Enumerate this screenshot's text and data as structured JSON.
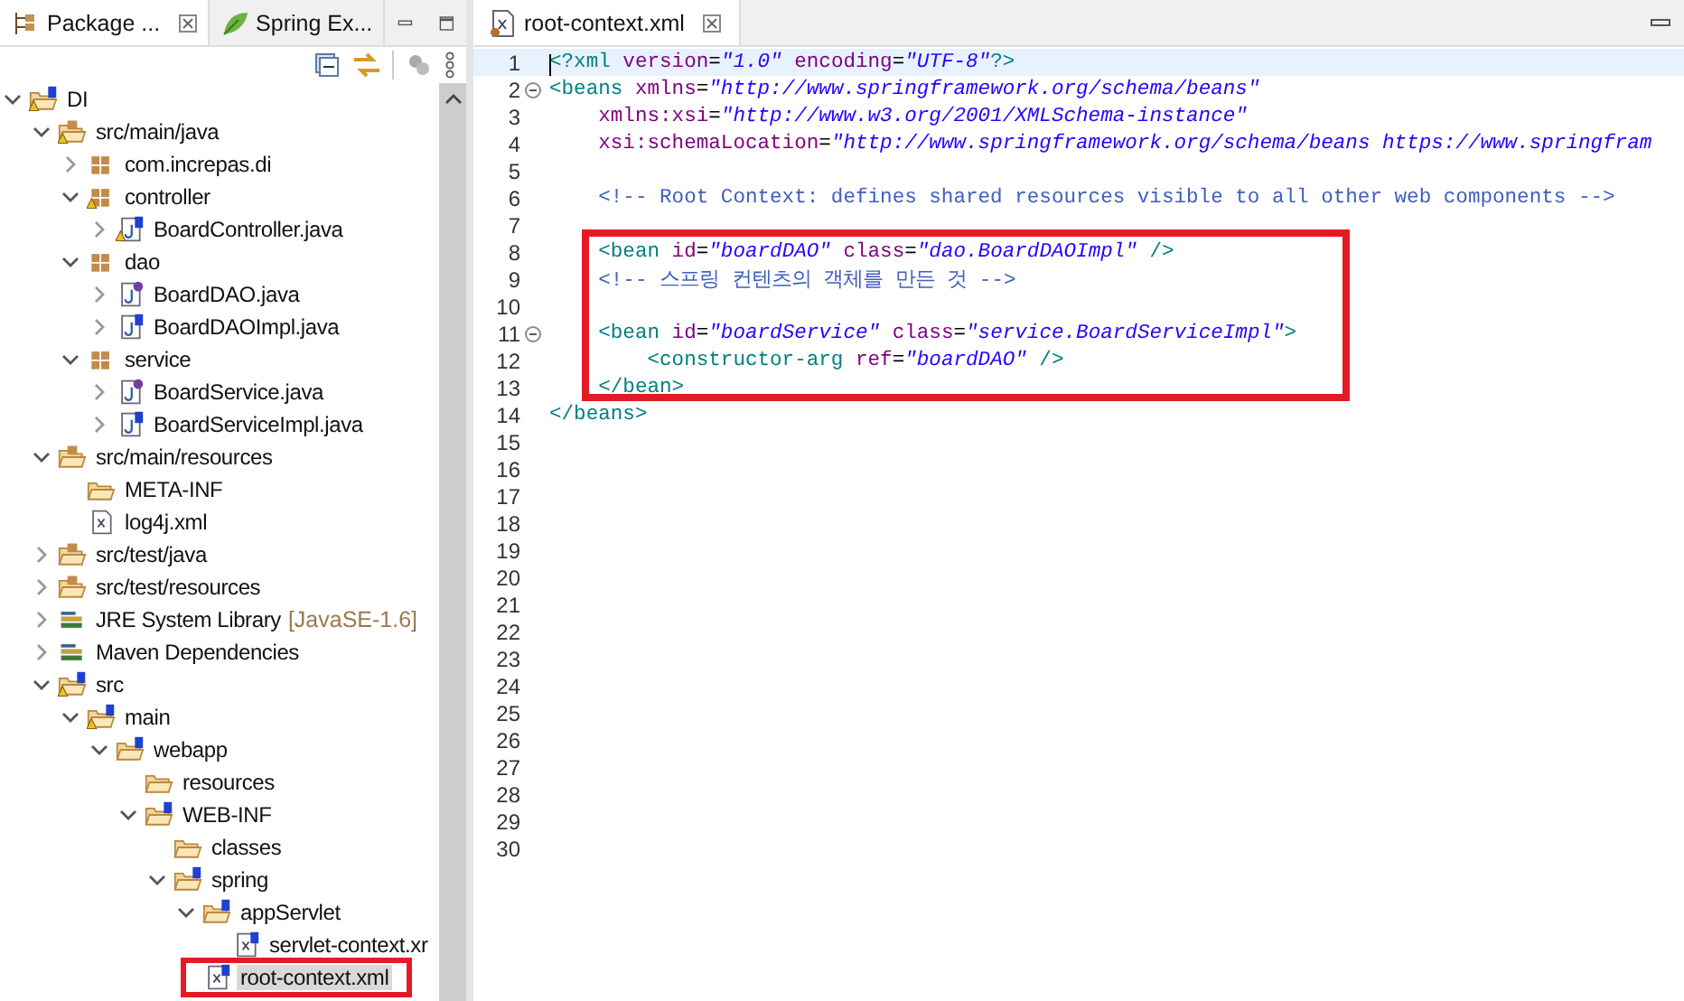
{
  "left_panel": {
    "tabs": [
      {
        "label": "Package ...",
        "kind": "package-explorer",
        "selected": true,
        "closable": true
      },
      {
        "label": "Spring Ex...",
        "kind": "spring-explorer",
        "selected": false,
        "closable": false
      }
    ],
    "tree": [
      {
        "label": "DI",
        "kind": "spring-project",
        "expanded": true,
        "warning": true,
        "selected": false,
        "children": [
          {
            "label": "src/main/java",
            "kind": "source-folder",
            "expanded": true,
            "warning": true,
            "selected": false,
            "children": [
              {
                "label": "com.increpas.di",
                "kind": "package",
                "expanded": false,
                "warning": false,
                "selected": false
              },
              {
                "label": "controller",
                "kind": "package",
                "expanded": true,
                "warning": true,
                "selected": false,
                "children": [
                  {
                    "label": "BoardController.java",
                    "kind": "spring-class",
                    "expanded": false,
                    "warning": true,
                    "selected": false
                  }
                ]
              },
              {
                "label": "dao",
                "kind": "package",
                "expanded": true,
                "warning": false,
                "selected": false,
                "children": [
                  {
                    "label": "BoardDAO.java",
                    "kind": "java-interface",
                    "expanded": false,
                    "warning": false,
                    "selected": false
                  },
                  {
                    "label": "BoardDAOImpl.java",
                    "kind": "spring-class",
                    "expanded": false,
                    "warning": false,
                    "selected": false
                  }
                ]
              },
              {
                "label": "service",
                "kind": "package",
                "expanded": true,
                "warning": false,
                "selected": false,
                "children": [
                  {
                    "label": "BoardService.java",
                    "kind": "java-interface",
                    "expanded": false,
                    "warning": false,
                    "selected": false
                  },
                  {
                    "label": "BoardServiceImpl.java",
                    "kind": "spring-class",
                    "expanded": false,
                    "warning": false,
                    "selected": false
                  }
                ]
              }
            ]
          },
          {
            "label": "src/main/resources",
            "kind": "source-folder",
            "expanded": true,
            "warning": false,
            "selected": false,
            "children": [
              {
                "label": "META-INF",
                "kind": "folder",
                "warning": false,
                "selected": false
              },
              {
                "label": "log4j.xml",
                "kind": "xml",
                "warning": false,
                "selected": false
              }
            ]
          },
          {
            "label": "src/test/java",
            "kind": "source-folder",
            "expanded": false,
            "warning": false,
            "selected": false
          },
          {
            "label": "src/test/resources",
            "kind": "source-folder",
            "expanded": false,
            "warning": false,
            "selected": false
          },
          {
            "label": "JRE System Library",
            "decoration": "[JavaSE-1.6]",
            "kind": "library",
            "expanded": false,
            "warning": false,
            "selected": false
          },
          {
            "label": "Maven Dependencies",
            "kind": "library",
            "expanded": false,
            "warning": false,
            "selected": false
          },
          {
            "label": "src",
            "kind": "spring-folder",
            "expanded": true,
            "warning": true,
            "selected": false,
            "children": [
              {
                "label": "main",
                "kind": "spring-folder",
                "expanded": true,
                "warning": true,
                "selected": false,
                "children": [
                  {
                    "label": "webapp",
                    "kind": "spring-folder",
                    "expanded": true,
                    "warning": false,
                    "selected": false,
                    "children": [
                      {
                        "label": "resources",
                        "kind": "folder",
                        "warning": false,
                        "selected": false
                      },
                      {
                        "label": "WEB-INF",
                        "kind": "spring-folder",
                        "expanded": true,
                        "warning": false,
                        "selected": false,
                        "children": [
                          {
                            "label": "classes",
                            "kind": "folder",
                            "warning": false,
                            "selected": false
                          },
                          {
                            "label": "spring",
                            "kind": "spring-folder",
                            "expanded": true,
                            "warning": false,
                            "selected": false,
                            "children": [
                              {
                                "label": "appServlet",
                                "kind": "spring-folder",
                                "expanded": true,
                                "warning": false,
                                "selected": false,
                                "children": [
                                  {
                                    "label": "servlet-context.xr",
                                    "kind": "spring-xml",
                                    "warning": false,
                                    "selected": false,
                                    "boxed": false
                                  }
                                ]
                              },
                              {
                                "label": "root-context.xml",
                                "kind": "spring-xml",
                                "warning": false,
                                "selected": true,
                                "boxed": true
                              }
                            ]
                          }
                        ]
                      }
                    ]
                  }
                ]
              }
            ]
          }
        ]
      }
    ]
  },
  "editor": {
    "tab": {
      "label": "root-context.xml",
      "selected": true
    },
    "blocks": [
      {
        "boxed": false,
        "lines": [
          {
            "number": "1",
            "current": true,
            "fold": false,
            "tokens": [
              {
                "kind": "tag",
                "t": "<?xml"
              },
              {
                "kind": "attr",
                "t": " version"
              },
              {
                "kind": "plain",
                "t": "="
              },
              {
                "kind": "value",
                "t": "\"1.0\""
              },
              {
                "kind": "attr",
                "t": " encoding"
              },
              {
                "kind": "plain",
                "t": "="
              },
              {
                "kind": "value",
                "t": "\"UTF-8\""
              },
              {
                "kind": "tag",
                "t": "?>"
              }
            ]
          },
          {
            "number": "2",
            "current": false,
            "fold": true,
            "tokens": [
              {
                "kind": "tag",
                "t": "<beans"
              },
              {
                "kind": "attr",
                "t": " xmlns"
              },
              {
                "kind": "plain",
                "t": "="
              },
              {
                "kind": "value",
                "t": "\"http://www.springframework.org/schema/beans\""
              }
            ]
          },
          {
            "number": "3",
            "current": false,
            "fold": false,
            "tokens": [
              {
                "kind": "attr",
                "t": "    xmlns:xsi"
              },
              {
                "kind": "plain",
                "t": "="
              },
              {
                "kind": "value",
                "t": "\"http://www.w3.org/2001/XMLSchema-instance\""
              }
            ]
          },
          {
            "number": "4",
            "current": false,
            "fold": false,
            "tokens": [
              {
                "kind": "attr",
                "t": "    xsi:schemaLocation"
              },
              {
                "kind": "plain",
                "t": "="
              },
              {
                "kind": "value",
                "t": "\"http://www.springframework.org/schema/beans https://www.springfram"
              }
            ]
          },
          {
            "number": "5",
            "current": false,
            "fold": false
          },
          {
            "number": "6",
            "current": false,
            "fold": false,
            "tokens": [
              {
                "kind": "comment",
                "t": "    <!-- Root Context: defines shared resources visible to all other web components -->"
              }
            ]
          },
          {
            "number": "7",
            "current": false,
            "fold": false
          }
        ]
      },
      {
        "boxed": true,
        "lines": [
          {
            "number": "8",
            "current": false,
            "fold": false,
            "tokens": [
              {
                "kind": "tag",
                "t": "    <bean"
              },
              {
                "kind": "attr",
                "t": " id"
              },
              {
                "kind": "plain",
                "t": "="
              },
              {
                "kind": "value",
                "t": "\"boardDAO\""
              },
              {
                "kind": "attr",
                "t": " class"
              },
              {
                "kind": "plain",
                "t": "="
              },
              {
                "kind": "value",
                "t": "\"dao.BoardDAOImpl\""
              },
              {
                "kind": "tag",
                "t": " />"
              }
            ]
          },
          {
            "number": "9",
            "current": false,
            "fold": false,
            "tokens": [
              {
                "kind": "comment",
                "t": "    <!-- 스프링 컨텐츠의 객체를 만든 것 -->"
              }
            ]
          },
          {
            "number": "10",
            "current": false,
            "fold": false
          },
          {
            "number": "11",
            "current": false,
            "fold": true,
            "tokens": [
              {
                "kind": "tag",
                "t": "    <bean"
              },
              {
                "kind": "attr",
                "t": " id"
              },
              {
                "kind": "plain",
                "t": "="
              },
              {
                "kind": "value",
                "t": "\"boardService\""
              },
              {
                "kind": "attr",
                "t": " class"
              },
              {
                "kind": "plain",
                "t": "="
              },
              {
                "kind": "value",
                "t": "\"service.BoardServiceImpl\""
              },
              {
                "kind": "tag",
                "t": ">"
              }
            ]
          },
          {
            "number": "12",
            "current": false,
            "fold": false,
            "tokens": [
              {
                "kind": "tag",
                "t": "        <constructor-arg"
              },
              {
                "kind": "attr",
                "t": " ref"
              },
              {
                "kind": "plain",
                "t": "="
              },
              {
                "kind": "value",
                "t": "\"boardDAO\""
              },
              {
                "kind": "tag",
                "t": " />"
              }
            ]
          },
          {
            "number": "13",
            "current": false,
            "fold": false,
            "tokens": [
              {
                "kind": "tag",
                "t": "    </bean>"
              }
            ]
          }
        ]
      },
      {
        "boxed": false,
        "lines": [
          {
            "number": "14",
            "current": false,
            "fold": false,
            "tokens": [
              {
                "kind": "tag",
                "t": "</beans>"
              }
            ]
          },
          {
            "number": "15",
            "current": false,
            "fold": false
          },
          {
            "number": "16",
            "current": false,
            "fold": false
          },
          {
            "number": "17",
            "current": false,
            "fold": false
          },
          {
            "number": "18",
            "current": false,
            "fold": false
          },
          {
            "number": "19",
            "current": false,
            "fold": false
          },
          {
            "number": "20",
            "current": false,
            "fold": false
          },
          {
            "number": "21",
            "current": false,
            "fold": false
          },
          {
            "number": "22",
            "current": false,
            "fold": false
          },
          {
            "number": "23",
            "current": false,
            "fold": false
          },
          {
            "number": "24",
            "current": false,
            "fold": false
          },
          {
            "number": "25",
            "current": false,
            "fold": false
          },
          {
            "number": "26",
            "current": false,
            "fold": false
          },
          {
            "number": "27",
            "current": false,
            "fold": false
          },
          {
            "number": "28",
            "current": false,
            "fold": false
          },
          {
            "number": "29",
            "current": false,
            "fold": false
          },
          {
            "number": "30",
            "current": false,
            "fold": false
          }
        ]
      }
    ]
  }
}
